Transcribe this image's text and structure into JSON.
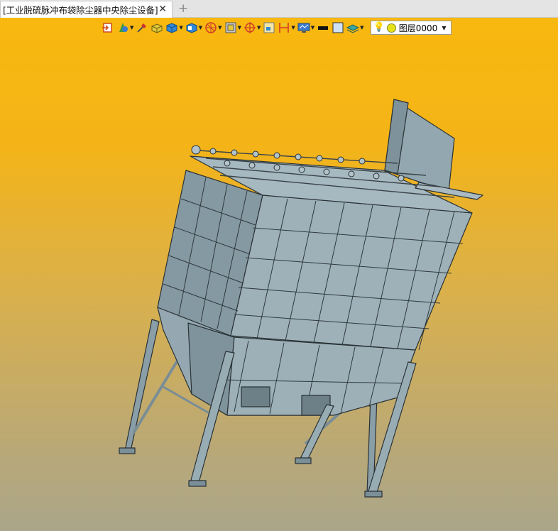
{
  "tab": {
    "title": "[工业脱硫脉冲布袋除尘器中央除尘设备]",
    "close_glyph": "✕",
    "new_tab_glyph": "+"
  },
  "toolbar": {
    "icons": [
      {
        "name": "exit-sketch-icon",
        "dropdown": false
      },
      {
        "name": "render-style-icon",
        "dropdown": true
      },
      {
        "name": "eyedropper-icon",
        "dropdown": false
      },
      {
        "name": "shaded-box-icon",
        "dropdown": false
      },
      {
        "name": "blue-cube-icon",
        "dropdown": true
      },
      {
        "name": "view-orientation-icon",
        "dropdown": true
      },
      {
        "name": "section-view-icon",
        "dropdown": true
      },
      {
        "name": "frame-icon",
        "dropdown": true
      },
      {
        "name": "target-icon",
        "dropdown": true
      },
      {
        "name": "fit-view-icon",
        "dropdown": false
      },
      {
        "name": "measure-icon",
        "dropdown": true
      },
      {
        "name": "display-icon",
        "dropdown": true
      },
      {
        "name": "line-color-icon",
        "dropdown": false
      },
      {
        "name": "fill-color-icon",
        "dropdown": false
      },
      {
        "name": "layer-stack-icon",
        "dropdown": true
      }
    ],
    "layer": {
      "name": "图层0000",
      "icons": [
        "lightbulb-icon",
        "layer-color-icon"
      ]
    }
  },
  "colors": {
    "background_top": "#f8b80f",
    "background_bottom": "#aaa68a",
    "model": "#8fa3ac",
    "model_edge": "#2a3236"
  }
}
